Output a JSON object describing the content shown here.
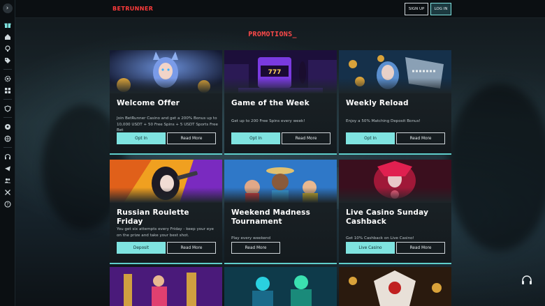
{
  "header": {
    "logo": "BETRUNNER",
    "signup_label": "SIGN UP",
    "login_label": "LOG IN"
  },
  "page_title": "PROMOTIONS_",
  "sidebar": {
    "toggle_icon": "chevron-right-icon",
    "icons": [
      "gift-icon",
      "home-icon",
      "lightbulb-icon",
      "tag-icon",
      "gear-icon",
      "apps-icon",
      "shield-icon",
      "soccer-icon",
      "basketball-icon",
      "headset-icon",
      "telegram-icon",
      "people-icon",
      "x-logo-icon",
      "help-icon"
    ]
  },
  "promotions": [
    {
      "title": "Welcome Offer",
      "description": "Join BetRunner Casino and get a 200% Bonus up to 10,000 USDT + 50 Free Spins + 5 USDT Sports Free Bet",
      "primary_label": "Opt In",
      "secondary_label": "Read More",
      "accent": "#7fe3e0"
    },
    {
      "title": "Game of the Week",
      "description": "Get up to 200 Free Spins every week!",
      "primary_label": "Opt In",
      "secondary_label": "Read More",
      "accent": "#7fe3e0"
    },
    {
      "title": "Weekly Reload",
      "description": "Enjoy a 50% Matching Deposit Bonus!",
      "primary_label": "Opt In",
      "secondary_label": "Read More",
      "accent": "#7fe3e0"
    },
    {
      "title": "Russian Roulette Friday",
      "description": "You get six attempts every Friday - keep your eye on the prize and take your best shot.",
      "primary_label": "Deposit",
      "secondary_label": "Read More",
      "accent": "#7fe3e0"
    },
    {
      "title": "Weekend Madness Tournament",
      "description": "Play every weekend",
      "primary_label": "",
      "secondary_label": "Read More",
      "accent": "#7fe3e0"
    },
    {
      "title": "Live Casino Sunday Cashback",
      "description": "Get 10% Cashback on Live Casino!",
      "primary_label": "Live Casino",
      "secondary_label": "Read More",
      "accent": "#7fe3e0"
    }
  ],
  "support_icon": "headset-icon"
}
